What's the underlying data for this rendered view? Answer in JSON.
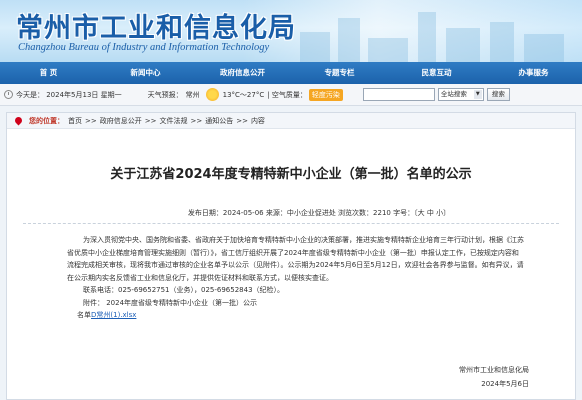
{
  "banner": {
    "title_cn": "常州市工业和信息化局",
    "title_en": "Changzhou Bureau of Industry and Information Technology"
  },
  "nav": [
    "首 页",
    "新闻中心",
    "政府信息公开",
    "专题专栏",
    "民意互动",
    "办事服务"
  ],
  "infobar": {
    "date_text": "今天是： 2024年5月13日 星期一",
    "weather_label": "天气预报：",
    "city": "常州",
    "temperature": "13°C～27°C",
    "aq_label": "| 空气质量：",
    "aq_value": "轻度污染",
    "search_placeholder": "",
    "select_value": "全站搜索",
    "search_button": "搜索"
  },
  "breadcrumb": {
    "label": "您的位置：",
    "items": [
      "首页",
      "政府信息公开",
      "文件法规",
      "通知公告",
      "内容"
    ]
  },
  "article": {
    "title": "关于江苏省2024年度专精特新中小企业（第一批）名单的公示",
    "meta_prefix": "发布日期：2024-05-06   来源：中小企业促进处  浏览次数：2210  字号：〔",
    "font_large": "大",
    "font_mid": "中",
    "font_small": "小",
    "meta_suffix": "〕",
    "paragraph1": "为深入贯彻党中央、国务院和省委、省政府关于加快培育专精特新中小企业的决策部署，推进实施专精特新企业培育三年行动计划，根据《江苏省优质中小企业梯度培育管理实施细则（暂行）》，省工信厅组织开展了2024年度省级专精特新中小企业（第一批）申报认定工作，已按规定内容和流程完成相关审核，现将我市通过审核的企业名单予以公示（见附件）。公示期为2024年5月6日至5月12日，欢迎社会各界参与监督。如有异议，请在公示期内实名反馈省工业和信息化厅，并提供佐证材料和联系方式，以便核实查证。",
    "contact": "联系电话：025-69652751（业务），025-69652843（纪检）。",
    "attachment": "附件：    2024年度省级专精特新中小企业（第一批）公示",
    "list_prefix": "名单",
    "list_link": "D常州(1).xlsx",
    "signature_org": "常州市工业和信息化局",
    "signature_date": "2024年5月6日"
  }
}
